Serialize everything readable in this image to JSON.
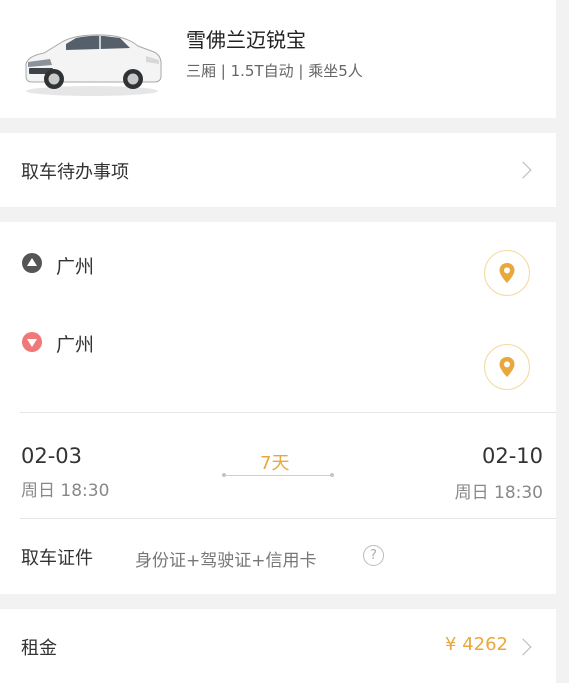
{
  "car": {
    "name": "雪佛兰迈锐宝",
    "spec": "三厢 | 1.5T自动 | 乘坐5人",
    "image_icon": "white-sedan"
  },
  "todo": {
    "label": "取车待办事项"
  },
  "location": {
    "pickup_city": "广州",
    "return_city": "广州",
    "pin_icon": "location-pin-icon"
  },
  "dates": {
    "pickup_date": "02-03",
    "pickup_time": "周日 18:30",
    "duration": "7天",
    "return_date": "02-10",
    "return_time": "周日 18:30"
  },
  "documents": {
    "label": "取车证件",
    "value": "身份证+驾驶证+信用卡",
    "help": "?"
  },
  "rent": {
    "label": "租金",
    "value": "¥ 4262"
  },
  "colors": {
    "accent": "#e8a83c",
    "pickup_dot": "#555555",
    "return_dot": "#f07878",
    "background": "#f2f2f2"
  }
}
